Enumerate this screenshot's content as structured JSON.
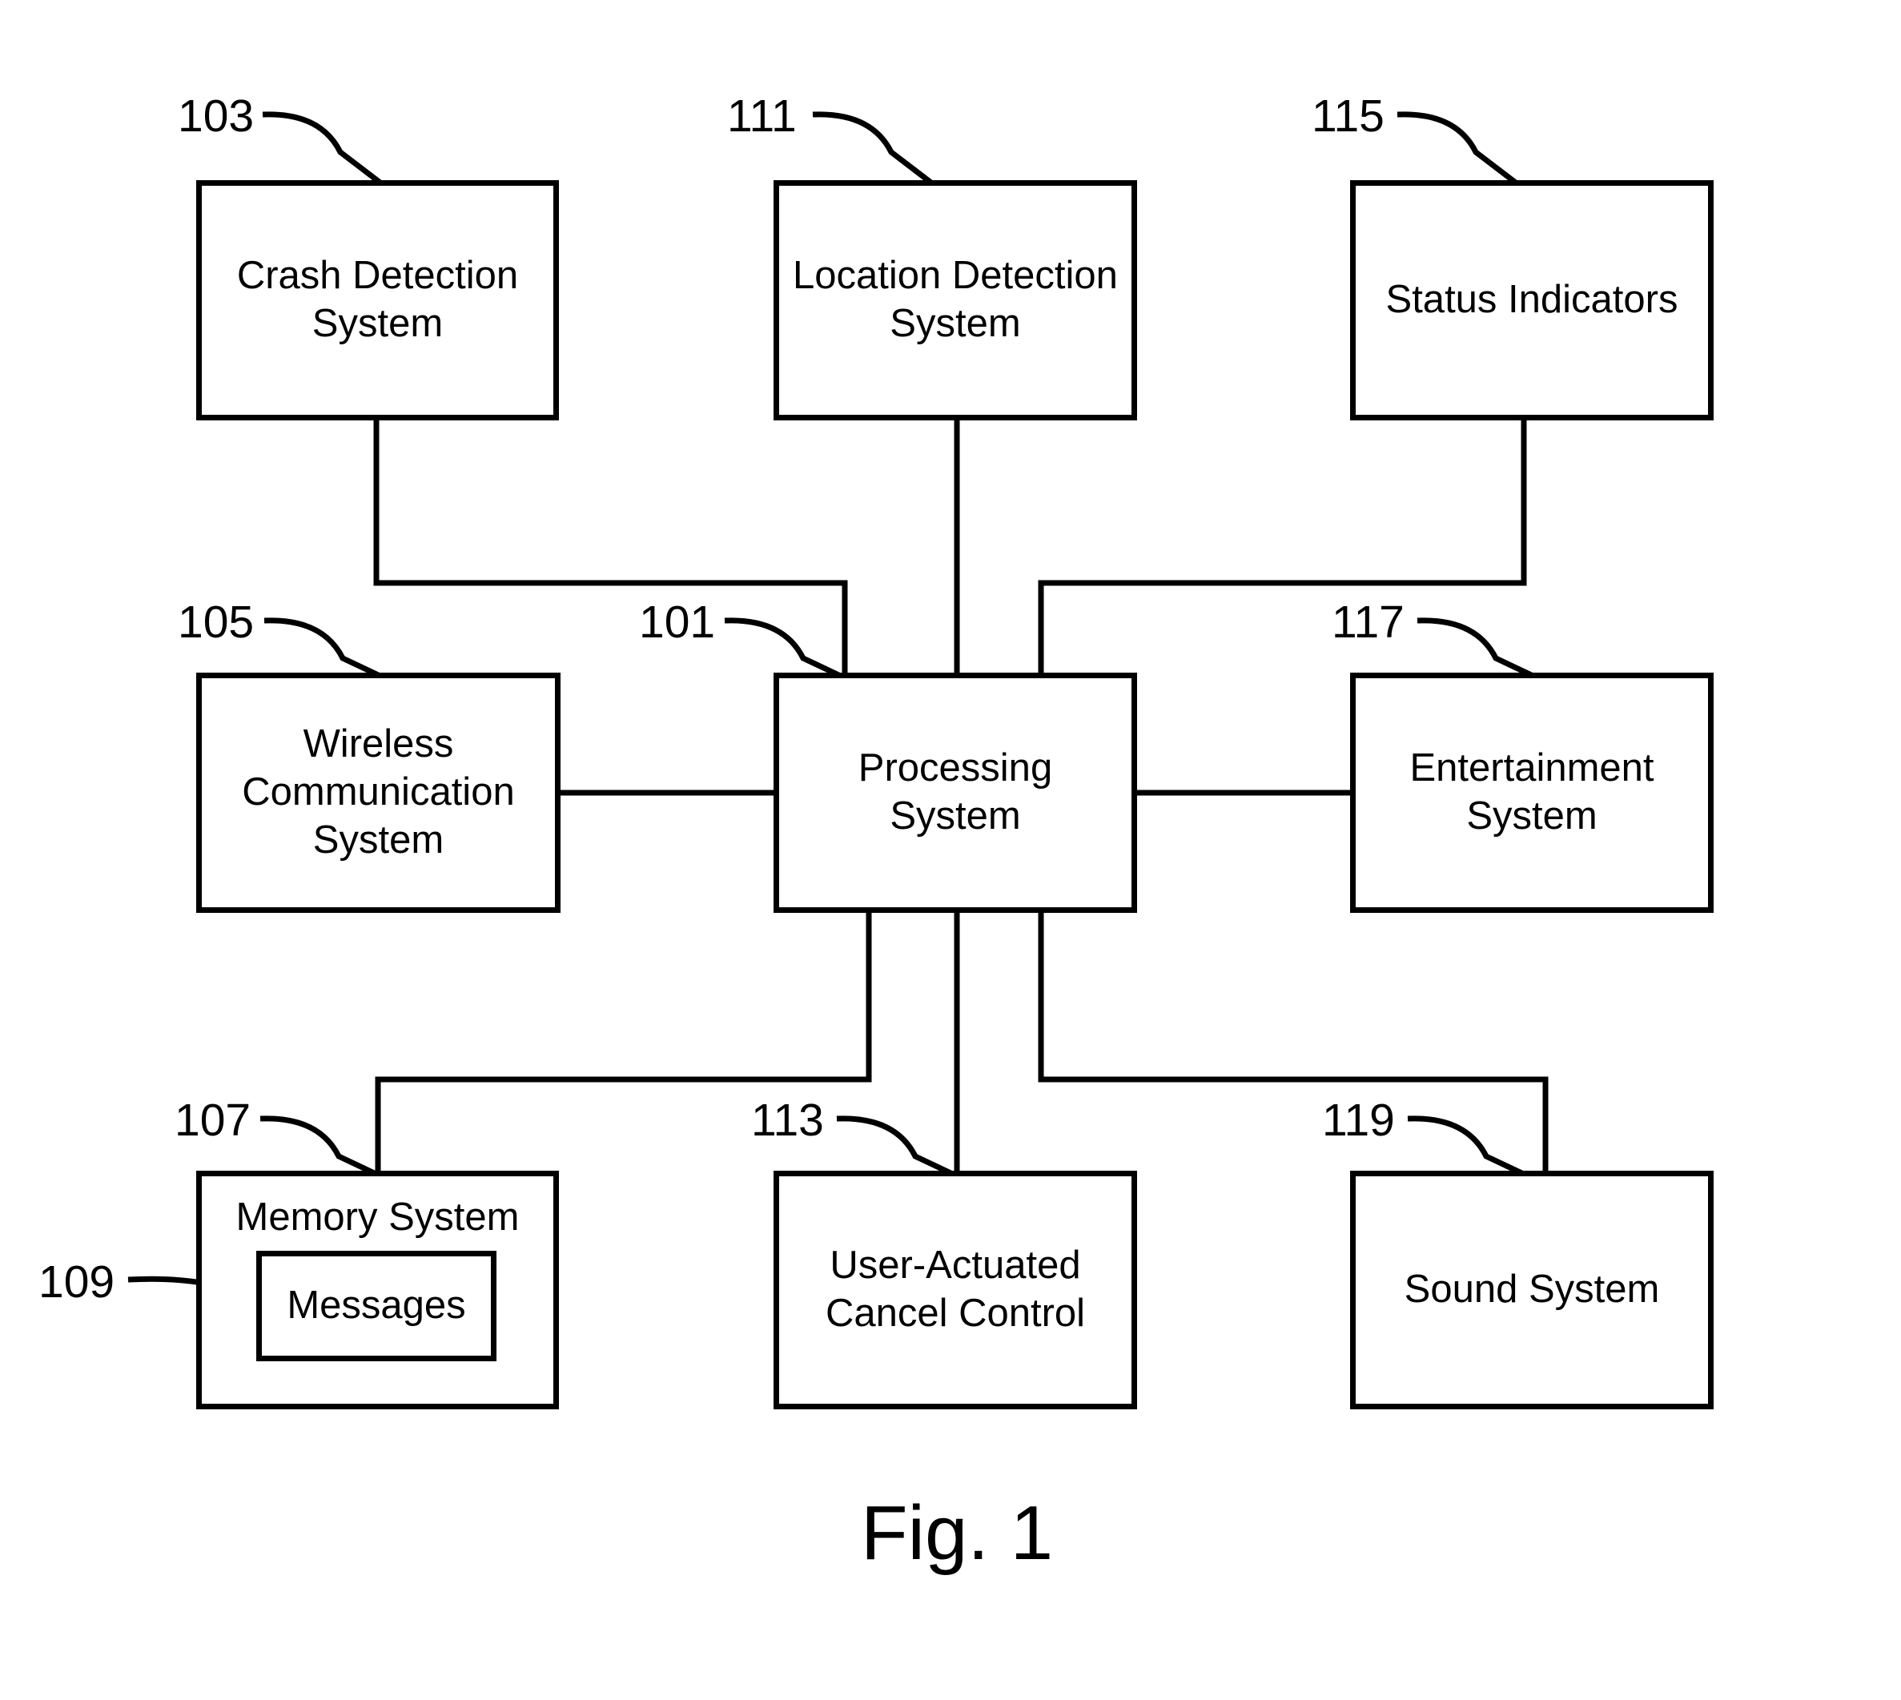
{
  "figure": {
    "caption": "Fig. 1",
    "line_color": "#000000",
    "background_color": "#ffffff"
  },
  "blocks": [
    {
      "id": "crash_detection",
      "ref": "103",
      "label": "Crash Detection\nSystem"
    },
    {
      "id": "location_detection",
      "ref": "111",
      "label": "Location Detection\nSystem"
    },
    {
      "id": "status_indicators",
      "ref": "115",
      "label": "Status Indicators"
    },
    {
      "id": "wireless_comm",
      "ref": "105",
      "label": "Wireless\nCommunication\nSystem"
    },
    {
      "id": "processing",
      "ref": "101",
      "label": "Processing\nSystem"
    },
    {
      "id": "entertainment",
      "ref": "117",
      "label": "Entertainment\nSystem"
    },
    {
      "id": "memory",
      "ref": "107",
      "label": "Memory System"
    },
    {
      "id": "messages",
      "ref": "109",
      "label": "Messages"
    },
    {
      "id": "cancel_control",
      "ref": "113",
      "label": "User-Actuated\nCancel Control"
    },
    {
      "id": "sound",
      "ref": "119",
      "label": "Sound System"
    }
  ],
  "labels": {
    "crash_detection": "Crash Detection\nSystem",
    "location_detection": "Location Detection\nSystem",
    "status_indicators": "Status Indicators",
    "wireless_comm": "Wireless\nCommunication\nSystem",
    "processing": "Processing\nSystem",
    "entertainment": "Entertainment\nSystem",
    "memory": "Memory System",
    "messages": "Messages",
    "cancel_control": "User-Actuated\nCancel Control",
    "sound": "Sound System"
  },
  "reference_numerals": {
    "crash_detection": "103",
    "wireless_comm": "105",
    "memory": "107",
    "messages": "109",
    "location_detection": "111",
    "cancel_control": "113",
    "status_indicators": "115",
    "entertainment": "117",
    "sound": "119",
    "processing": "101"
  },
  "connections": [
    {
      "from": "crash_detection",
      "to": "processing",
      "style": "orthogonal"
    },
    {
      "from": "location_detection",
      "to": "processing",
      "style": "straight-vertical"
    },
    {
      "from": "status_indicators",
      "to": "processing",
      "style": "orthogonal"
    },
    {
      "from": "wireless_comm",
      "to": "processing",
      "style": "straight-horizontal"
    },
    {
      "from": "entertainment",
      "to": "processing",
      "style": "straight-horizontal"
    },
    {
      "from": "memory",
      "to": "processing",
      "style": "orthogonal"
    },
    {
      "from": "cancel_control",
      "to": "processing",
      "style": "straight-vertical"
    },
    {
      "from": "sound",
      "to": "processing",
      "style": "orthogonal"
    }
  ]
}
